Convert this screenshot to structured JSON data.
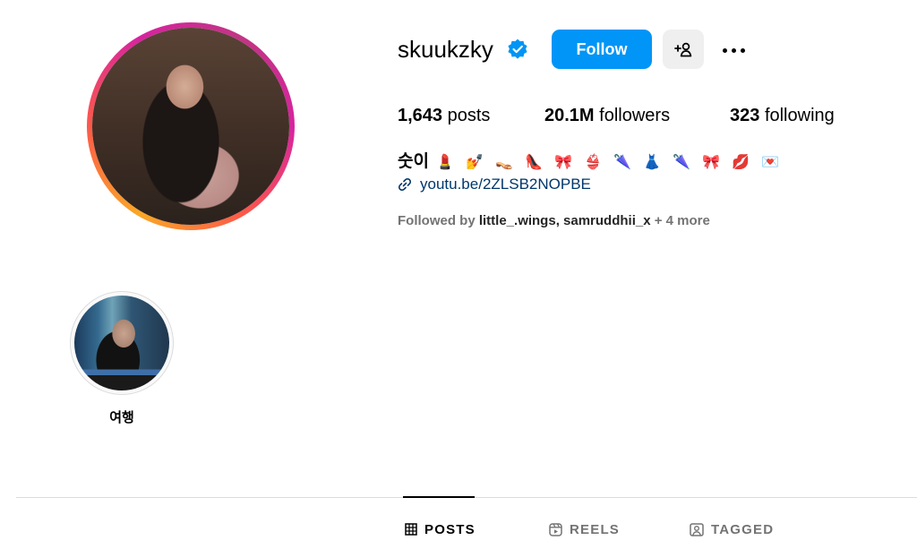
{
  "profile": {
    "username": "skuukzky",
    "verified": true,
    "follow_label": "Follow",
    "stats": {
      "posts_count": "1,643",
      "posts_label": "posts",
      "followers_count": "20.1M",
      "followers_label": "followers",
      "following_count": "323",
      "following_label": "following"
    },
    "bio": {
      "name": "숫이",
      "emojis": "💄 💅 👡 👠 🎀 👙 🌂 👗 🌂 🎀 💋 💌",
      "link": "youtu.be/2ZLSB2NOPBE"
    },
    "followed_by": {
      "prefix": "Followed by",
      "accounts": "little_.wings, samruddhii_x",
      "more": "+ 4 more"
    }
  },
  "highlights": [
    {
      "label": "여행"
    }
  ],
  "tabs": [
    {
      "label": "POSTS",
      "icon": "grid-icon",
      "active": true
    },
    {
      "label": "REELS",
      "icon": "reels-icon",
      "active": false
    },
    {
      "label": "TAGGED",
      "icon": "tagged-icon",
      "active": false
    }
  ],
  "colors": {
    "follow_button": "#0095f6",
    "verified_badge": "#0095f6",
    "link": "#00376b",
    "muted_text": "#737373"
  }
}
